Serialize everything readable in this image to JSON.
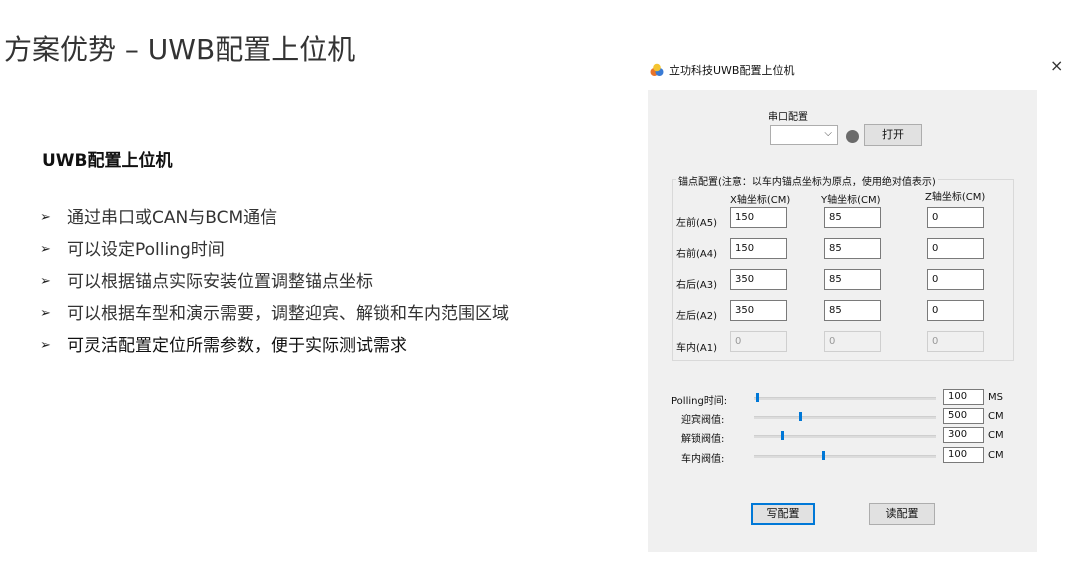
{
  "slide": {
    "title": "方案优势 – UWB配置上位机",
    "heading": "UWB配置上位机",
    "bullets": [
      "通过串口或CAN与BCM通信",
      "可以设定Polling时间",
      "可以根据锚点实际安装位置调整锚点坐标",
      "可以根据车型和演示需要，调整迎宾、解锁和车内范围区域",
      "可灵活配置定位所需参数，便于实际测试需求"
    ],
    "bullet_marker": "➢"
  },
  "window": {
    "title": "立功科技UWB配置上位机",
    "close": "×",
    "serial": {
      "group_label": "串口配置",
      "port_value": "",
      "open_button": "打开",
      "status_color": "#6b6b6b"
    },
    "anchors": {
      "group_label": "锚点配置(注意：以车内锚点坐标为原点，使用绝对值表示)",
      "columns": [
        "X轴坐标(CM)",
        "Y轴坐标(CM)",
        "Z轴坐标(CM)"
      ],
      "rows": [
        {
          "label": "左前(A5)",
          "x": "150",
          "y": "85",
          "z": "0",
          "enabled": true
        },
        {
          "label": "右前(A4)",
          "x": "150",
          "y": "85",
          "z": "0",
          "enabled": true
        },
        {
          "label": "右后(A3)",
          "x": "350",
          "y": "85",
          "z": "0",
          "enabled": true
        },
        {
          "label": "左后(A2)",
          "x": "350",
          "y": "85",
          "z": "0",
          "enabled": true
        },
        {
          "label": "车内(A1)",
          "x": "0",
          "y": "0",
          "z": "0",
          "enabled": false
        }
      ]
    },
    "params": [
      {
        "label": "Polling时间:",
        "value": "100",
        "unit": "MS",
        "level": 0.01
      },
      {
        "label": "迎宾阀值:",
        "value": "500",
        "unit": "CM",
        "level": 0.25
      },
      {
        "label": "解锁阀值:",
        "value": "300",
        "unit": "CM",
        "level": 0.15
      },
      {
        "label": "车内阀值:",
        "value": "100",
        "unit": "CM",
        "level": 0.38
      }
    ],
    "write_button": "写配置",
    "read_button": "读配置",
    "accent_color": "#0078d7"
  }
}
